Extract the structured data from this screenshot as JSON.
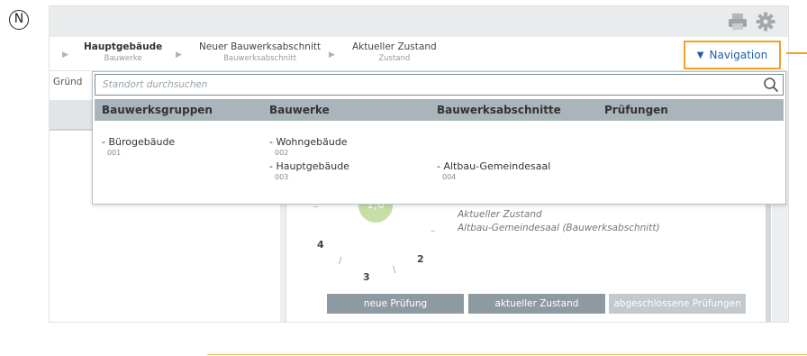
{
  "marker_letter": "N",
  "colors": {
    "accent": "#f4a126",
    "link_blue": "#1f5fa8",
    "header_gray": "#aab5bb",
    "score_green": "#c5dfa6"
  },
  "toolbar": {
    "icons": [
      "printer-icon",
      "gear-icon"
    ]
  },
  "breadcrumb": [
    {
      "title": "Hauptgebäude",
      "subtitle": "Bauwerke"
    },
    {
      "title": "Neuer Bauwerksabschnitt",
      "subtitle": "Bauwerksabschnitt"
    },
    {
      "title": "Aktueller Zustand",
      "subtitle": "Zustand"
    }
  ],
  "navigation_button": {
    "label": "Navigation"
  },
  "left_panel": {
    "tab_label": "Gründ"
  },
  "search": {
    "placeholder": "Standort durchsuchen"
  },
  "columns": [
    "Bauwerksgruppen",
    "Bauwerke",
    "Bauwerksabschnitte",
    "Prüfungen"
  ],
  "tree": {
    "groups": [
      {
        "name": "- Bürogebäude",
        "code": "001"
      }
    ],
    "buildings": [
      {
        "name": "- Wohngebäude",
        "code": "002"
      },
      {
        "name": "- Hauptgebäude",
        "code": "003"
      }
    ],
    "sections": [
      {
        "name": "- Altbau-Gemeindesaal",
        "code": "004"
      }
    ]
  },
  "main": {
    "score": "1,0",
    "state_label": "Aktueller Zustand",
    "section_label": "Altbau-Gemeindesaal (Bauwerksabschnitt)",
    "scale_numbers": [
      "4",
      "2",
      "3"
    ],
    "buttons": [
      "neue Prüfung",
      "aktueller Zustand",
      "abgeschlossene Prüfungen"
    ]
  }
}
